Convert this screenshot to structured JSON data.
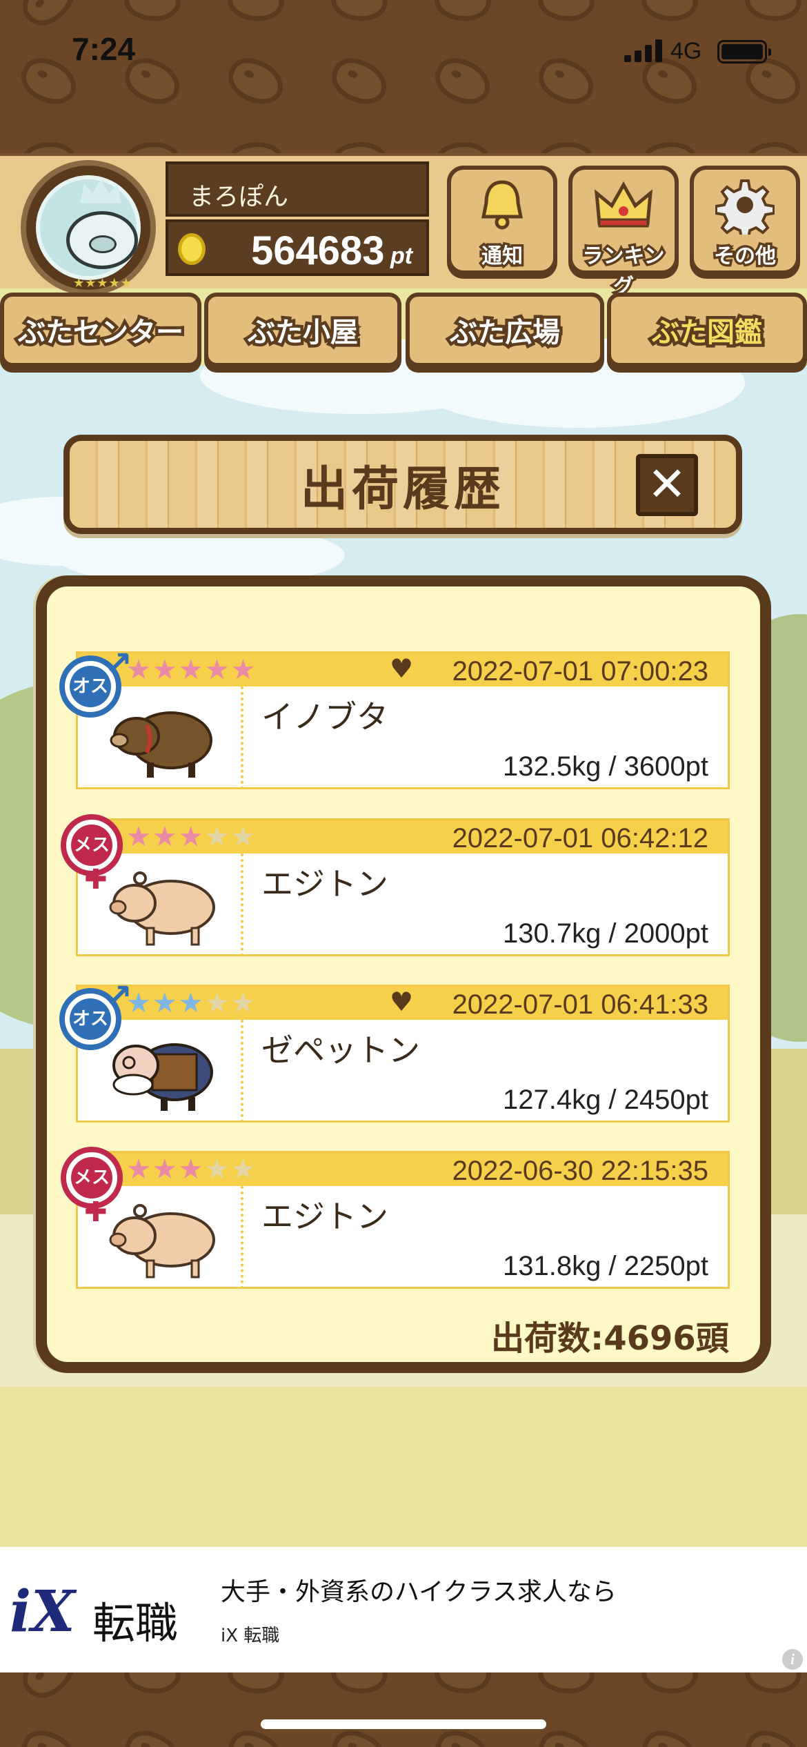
{
  "status_bar": {
    "time": "7:24",
    "network": "4G"
  },
  "header": {
    "username": "まろぽん",
    "points": "564683",
    "points_unit": "pt",
    "buttons": [
      {
        "label": "通知",
        "icon": "bell-icon"
      },
      {
        "label": "ランキング",
        "icon": "crown-icon"
      },
      {
        "label": "その他",
        "icon": "gear-icon"
      }
    ]
  },
  "tabs": [
    {
      "label": "ぶたセンター",
      "active": false
    },
    {
      "label": "ぶた小屋",
      "active": false
    },
    {
      "label": "ぶた広場",
      "active": false
    },
    {
      "label": "ぶた図鑑",
      "active": true
    }
  ],
  "modal": {
    "title": "出荷履歴",
    "close_label": "✕",
    "records": [
      {
        "gender": "オス",
        "stars": 5,
        "star_color": "#e98aa6",
        "favorite": true,
        "datetime": "2022-07-01 07:00:23",
        "name": "イノブタ",
        "weight_points": "132.5kg / 3600pt"
      },
      {
        "gender": "メス",
        "stars": 3,
        "star_color": "#e98aa6",
        "favorite": false,
        "datetime": "2022-07-01 06:42:12",
        "name": "エジトン",
        "weight_points": "130.7kg / 2000pt"
      },
      {
        "gender": "オス",
        "stars": 3,
        "star_color": "#7fb6e6",
        "favorite": true,
        "datetime": "2022-07-01 06:41:33",
        "name": "ゼペットン",
        "weight_points": "127.4kg / 2450pt"
      },
      {
        "gender": "メス",
        "stars": 3,
        "star_color": "#e98aa6",
        "favorite": false,
        "datetime": "2022-06-30 22:15:35",
        "name": "エジトン",
        "weight_points": "131.8kg / 2250pt"
      }
    ],
    "total": "出荷数:4696頭"
  },
  "ad": {
    "logo_mark": "iX",
    "logo_text": "転職",
    "headline": "大手・外資系のハイクラス求人なら",
    "advertiser": "iX 転職",
    "info": "i"
  }
}
